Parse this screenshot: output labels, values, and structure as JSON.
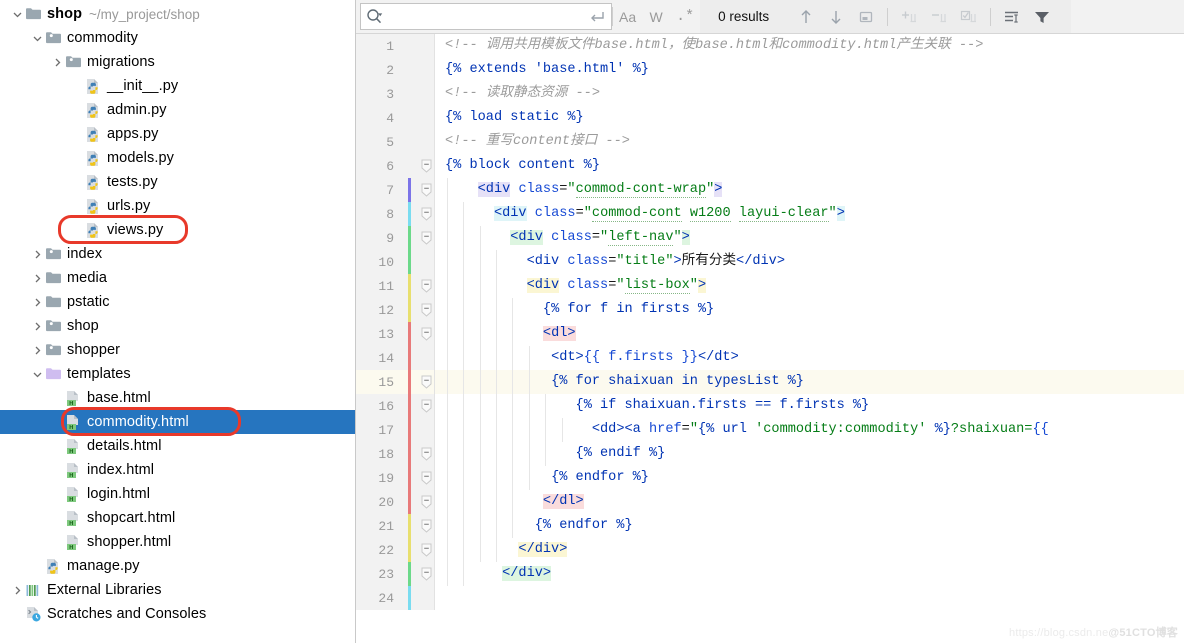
{
  "sidebar": {
    "items": [
      {
        "indent": 0,
        "arrow": "down",
        "icon": "folder-blue",
        "label": "shop",
        "bold": true,
        "sub": "~/my_project/shop"
      },
      {
        "indent": 1,
        "arrow": "down",
        "icon": "folder-module",
        "label": "commodity"
      },
      {
        "indent": 2,
        "arrow": "right",
        "icon": "folder-module",
        "label": "migrations"
      },
      {
        "indent": 3,
        "arrow": "none",
        "icon": "python-file",
        "label": "__init__.py"
      },
      {
        "indent": 3,
        "arrow": "none",
        "icon": "python-file",
        "label": "admin.py"
      },
      {
        "indent": 3,
        "arrow": "none",
        "icon": "python-file",
        "label": "apps.py"
      },
      {
        "indent": 3,
        "arrow": "none",
        "icon": "python-file",
        "label": "models.py"
      },
      {
        "indent": 3,
        "arrow": "none",
        "icon": "python-file",
        "label": "tests.py"
      },
      {
        "indent": 3,
        "arrow": "none",
        "icon": "python-file",
        "label": "urls.py"
      },
      {
        "indent": 3,
        "arrow": "none",
        "icon": "python-file",
        "label": "views.py",
        "annotated": true
      },
      {
        "indent": 1,
        "arrow": "right",
        "icon": "folder-module",
        "label": "index"
      },
      {
        "indent": 1,
        "arrow": "right",
        "icon": "folder-plain",
        "label": "media"
      },
      {
        "indent": 1,
        "arrow": "right",
        "icon": "folder-plain",
        "label": "pstatic"
      },
      {
        "indent": 1,
        "arrow": "right",
        "icon": "folder-module",
        "label": "shop"
      },
      {
        "indent": 1,
        "arrow": "right",
        "icon": "folder-module",
        "label": "shopper"
      },
      {
        "indent": 1,
        "arrow": "down",
        "icon": "folder-templates",
        "label": "templates"
      },
      {
        "indent": 2,
        "arrow": "none",
        "icon": "html-file",
        "label": "base.html"
      },
      {
        "indent": 2,
        "arrow": "none",
        "icon": "html-file",
        "label": "commodity.html",
        "selected": true,
        "annotated": true
      },
      {
        "indent": 2,
        "arrow": "none",
        "icon": "html-file",
        "label": "details.html"
      },
      {
        "indent": 2,
        "arrow": "none",
        "icon": "html-file",
        "label": "index.html"
      },
      {
        "indent": 2,
        "arrow": "none",
        "icon": "html-file",
        "label": "login.html"
      },
      {
        "indent": 2,
        "arrow": "none",
        "icon": "html-file",
        "label": "shopcart.html"
      },
      {
        "indent": 2,
        "arrow": "none",
        "icon": "html-file",
        "label": "shopper.html"
      },
      {
        "indent": 1,
        "arrow": "none",
        "icon": "python-file",
        "label": "manage.py"
      },
      {
        "indent": 0,
        "arrow": "right",
        "icon": "external-libraries",
        "label": "External Libraries"
      },
      {
        "indent": 0,
        "arrow": "none",
        "icon": "scratches",
        "label": "Scratches and Consoles"
      }
    ],
    "annotation_color": "#e8392a",
    "selection_color": "#2675bf"
  },
  "findbar": {
    "search_value": "",
    "search_placeholder": "",
    "match_case_label": "Aa",
    "words_label": "W",
    "regex_label": ".*",
    "results_label": "0 results",
    "icons": [
      "search-icon",
      "search-history-dropdown-icon",
      "multiline-toggle-icon",
      "prev-occurrence-icon",
      "next-occurrence-icon",
      "select-in-editor-icon",
      "add-occurrence-icon",
      "remove-occurrence-icon",
      "select-all-occurrences-icon",
      "open-in-find-window-icon",
      "filter-icon"
    ]
  },
  "editor": {
    "current_line": 15,
    "first_line_icon": "python-file",
    "lines": [
      {
        "n": 1,
        "fold": false,
        "bar": null,
        "indent": 0
      },
      {
        "n": 2,
        "fold": false,
        "bar": null,
        "indent": 0
      },
      {
        "n": 3,
        "fold": false,
        "bar": null,
        "indent": 0
      },
      {
        "n": 4,
        "fold": false,
        "bar": null,
        "indent": 0
      },
      {
        "n": 5,
        "fold": false,
        "bar": null,
        "indent": 0
      },
      {
        "n": 6,
        "fold": true,
        "bar": null,
        "indent": 0
      },
      {
        "n": 7,
        "fold": true,
        "bar": "#7c74e8",
        "indent": 1
      },
      {
        "n": 8,
        "fold": true,
        "bar": "#7adcf0",
        "indent": 2
      },
      {
        "n": 9,
        "fold": true,
        "bar": "#6cd98a",
        "indent": 3
      },
      {
        "n": 10,
        "fold": false,
        "bar": "#6cd98a",
        "indent": 4
      },
      {
        "n": 11,
        "fold": true,
        "bar": "#e8df6e",
        "indent": 4
      },
      {
        "n": 12,
        "fold": true,
        "bar": "#e8df6e",
        "indent": 5
      },
      {
        "n": 13,
        "fold": true,
        "bar": "#e87a7a",
        "indent": 5
      },
      {
        "n": 14,
        "fold": false,
        "bar": "#e87a7a",
        "indent": 6
      },
      {
        "n": 15,
        "fold": true,
        "bar": "#e87a7a",
        "indent": 6
      },
      {
        "n": 16,
        "fold": true,
        "bar": "#e87a7a",
        "indent": 7
      },
      {
        "n": 17,
        "fold": false,
        "bar": "#e87a7a",
        "indent": 8
      },
      {
        "n": 18,
        "fold": true,
        "bar": "#e87a7a",
        "indent": 7
      },
      {
        "n": 19,
        "fold": true,
        "bar": "#e87a7a",
        "indent": 6
      },
      {
        "n": 20,
        "fold": true,
        "bar": "#e87a7a",
        "indent": 5
      },
      {
        "n": 21,
        "fold": true,
        "bar": "#e8df6e",
        "indent": 5
      },
      {
        "n": 22,
        "fold": true,
        "bar": "#e8df6e",
        "indent": 4
      },
      {
        "n": 23,
        "fold": true,
        "bar": "#6cd98a",
        "indent": 2
      },
      {
        "n": 24,
        "fold": false,
        "bar": "#7adcf0",
        "indent": 0
      }
    ],
    "code": [
      "<!-- 调用共用模板文件base.html，使base.html和commodity.html产生关联 -->",
      "{% extends 'base.html' %}",
      "<!-- 读取静态资源 -->",
      "{% load static %}",
      "<!-- 重写content接口 -->",
      "{% block content %}",
      "    <div class=\"commod-cont-wrap\">",
      "      <div class=\"commod-cont w1200 layui-clear\">",
      "        <div class=\"left-nav\">",
      "          <div class=\"title\">所有分类</div>",
      "          <div class=\"list-box\">",
      "            {% for f in firsts %}",
      "            <dl>",
      "             <dt>{{ f.firsts }}</dt>",
      "             {% for shaixuan in typesList %}",
      "                {% if shaixuan.firsts == f.firsts %}",
      "                  <dd><a href=\"{% url 'commodity:commodity' %}?shaixuan={{",
      "                {% endif %}",
      "             {% endfor %}",
      "            </dl>",
      "           {% endfor %}",
      "         </div>",
      "       </div>",
      ""
    ]
  },
  "watermark": {
    "url": "https://blog.csdn.ne",
    "brand": "@51CTO博客"
  }
}
